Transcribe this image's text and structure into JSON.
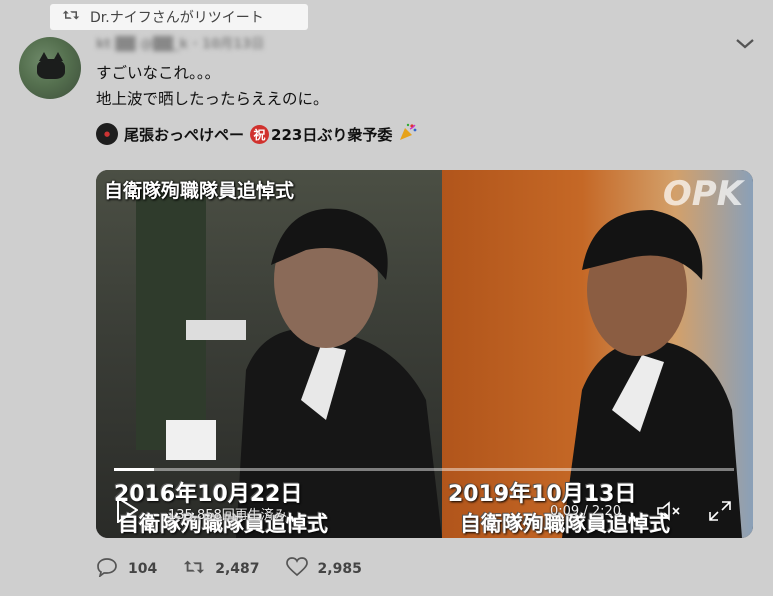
{
  "retweet_banner": {
    "text": "Dr.ナイフさんがリツイート",
    "icon": "retweet-icon"
  },
  "tweet": {
    "author_blurred": "kt ██ @██_k · 10月13日",
    "line1": "すごいなこれ。。。",
    "line2": "地上波で晒したったらええのに。"
  },
  "quote": {
    "author_name": "尾張おっぺけペー",
    "badge": "祝",
    "suffix": "223日ぶり衆予委",
    "emoji": "party-popper-icon"
  },
  "video": {
    "caption_top": "自衛隊殉職隊員追悼式",
    "watermark": "OPK",
    "date_left": "2016年10月22日",
    "date_right": "2019年10月13日",
    "sub_left": "自衛隊殉職隊員追悼式",
    "sub_right": "自衛隊殉職隊員追悼式",
    "views": "135,858回再生済み",
    "time": "0:09 / 2:20",
    "progress_fraction": 0.065
  },
  "actions": {
    "replies": "104",
    "retweets": "2,487",
    "likes": "2,985"
  },
  "colors": {
    "background": "#cfcfcf",
    "badge_red": "#d0312d"
  }
}
